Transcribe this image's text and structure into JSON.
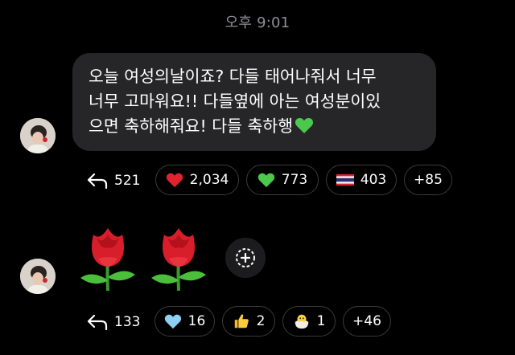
{
  "timestamp": "오후 9:01",
  "messages": [
    {
      "text": "오늘 여성의날이죠? 다들 태어나줘서 너무\n너무 고마워요!! 다들옆에 아는 여성분이있\n으면 축하해줘요! 다들 축하행",
      "trailing_emoji": "green-heart",
      "replies": "521",
      "reactions": [
        {
          "icon": "red-heart-icon",
          "count": "2,034"
        },
        {
          "icon": "green-heart-icon",
          "count": "773"
        },
        {
          "icon": "thailand-flag-icon",
          "count": "403"
        },
        {
          "label": "+85"
        }
      ]
    },
    {
      "content": [
        "rose-emoji",
        "rose-emoji"
      ],
      "replies": "133",
      "reactions": [
        {
          "icon": "light-blue-heart-icon",
          "count": "16"
        },
        {
          "icon": "thumbs-up-icon",
          "count": "2"
        },
        {
          "icon": "hatching-chick-icon",
          "count": "1"
        },
        {
          "label": "+46"
        }
      ]
    }
  ],
  "colors": {
    "background": "#000000",
    "bubble": "#262628",
    "pill_border": "#3a3a3c",
    "timestamp": "#8e8e93",
    "green_heart": "#4cc94c",
    "red_heart": "#e0242f",
    "blue_heart": "#8fcff2"
  }
}
